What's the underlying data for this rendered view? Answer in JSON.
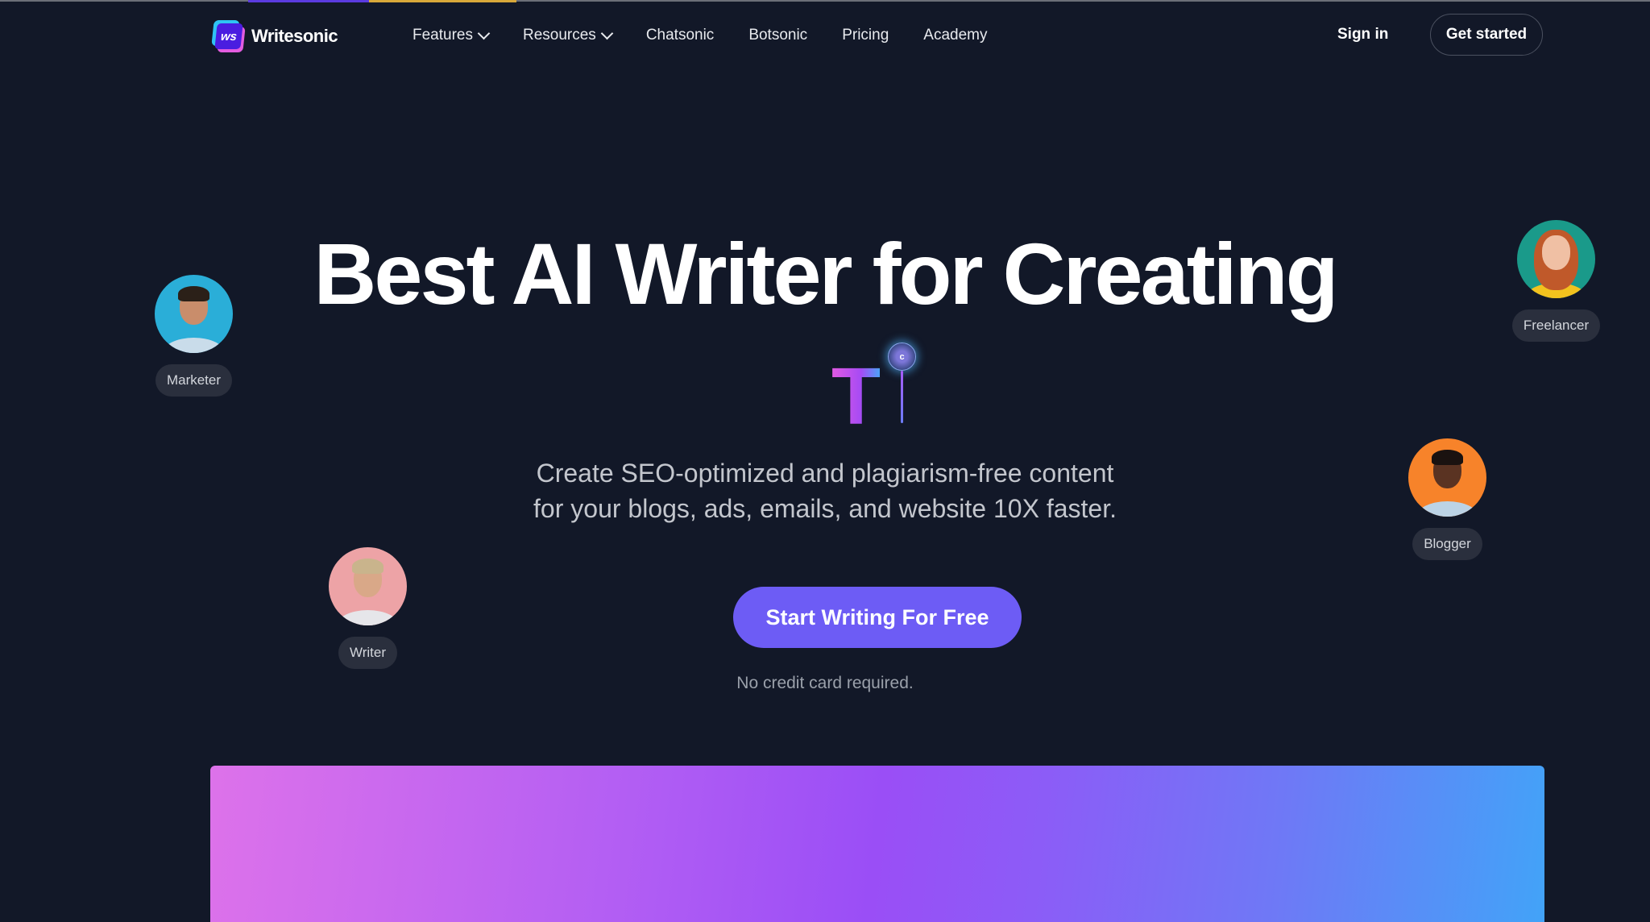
{
  "nav": {
    "logo_mark": "ws",
    "logo_text": "Writesonic",
    "menu": [
      {
        "label": "Features",
        "dropdown": true
      },
      {
        "label": "Resources",
        "dropdown": true
      },
      {
        "label": "Chatsonic",
        "dropdown": false
      },
      {
        "label": "Botsonic",
        "dropdown": false
      },
      {
        "label": "Pricing",
        "dropdown": false
      },
      {
        "label": "Academy",
        "dropdown": false
      }
    ],
    "sign_in": "Sign in",
    "get_started": "Get started"
  },
  "hero": {
    "headline": "Best AI Writer for Creating",
    "typing_text": "T",
    "cursor_icon_glyph": "c",
    "subtitle_line1": "Create SEO-optimized and plagiarism-free content",
    "subtitle_line2": "for your blogs, ads, emails, and website 10X faster.",
    "cta": "Start Writing For Free",
    "note": "No credit card required."
  },
  "personas": [
    {
      "label": "Marketer",
      "bg": "#2aaed8"
    },
    {
      "label": "Freelancer",
      "bg": "#1a9a8a"
    },
    {
      "label": "Blogger",
      "bg": "#f7832a"
    },
    {
      "label": "Writer",
      "bg": "#eda3a6"
    }
  ],
  "colors": {
    "background": "#121828",
    "cta": "#6d5cf5",
    "tag_bg": "#2a2f3d"
  }
}
